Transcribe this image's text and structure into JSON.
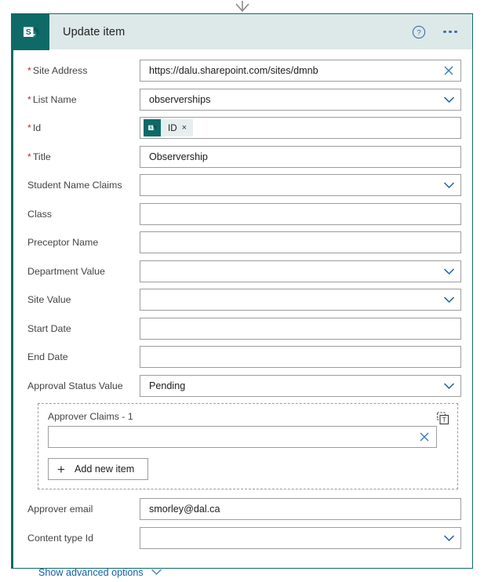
{
  "connector": {
    "icon": "arrow-down-icon"
  },
  "header": {
    "app_icon": "sharepoint-icon",
    "title": "Update item",
    "help_icon": "help-circle-icon",
    "more_icon": "ellipsis-icon"
  },
  "colors": {
    "accent_teal": "#0f6a67",
    "header_bg": "#dde8e8",
    "link_blue": "#0f5fa8",
    "chevron_blue": "#1b5fa8",
    "required_red": "#c1272d",
    "border_gray": "#9d9d9d"
  },
  "fields": [
    {
      "label": "Site Address",
      "required": true,
      "value": "https://dalu.sharepoint.com/sites/dmnb",
      "icon": "clear-x-icon",
      "type": "text"
    },
    {
      "label": "List Name",
      "required": true,
      "value": "observerships",
      "icon": "chevron-down-icon",
      "type": "dropdown"
    },
    {
      "label": "Id",
      "required": true,
      "value": "",
      "icon": "none",
      "type": "token",
      "token": {
        "icon": "sharepoint-icon",
        "label": "ID",
        "remove": "×"
      }
    },
    {
      "label": "Title",
      "required": true,
      "value": "Observership",
      "icon": "none",
      "type": "text"
    },
    {
      "label": "Student Name Claims",
      "required": false,
      "value": "",
      "icon": "chevron-down-icon",
      "type": "dropdown"
    },
    {
      "label": "Class",
      "required": false,
      "value": "",
      "icon": "none",
      "type": "text"
    },
    {
      "label": "Preceptor Name",
      "required": false,
      "value": "",
      "icon": "none",
      "type": "text"
    },
    {
      "label": "Department Value",
      "required": false,
      "value": "",
      "icon": "chevron-down-icon",
      "type": "dropdown"
    },
    {
      "label": "Site Value",
      "required": false,
      "value": "",
      "icon": "chevron-down-icon",
      "type": "dropdown"
    },
    {
      "label": "Start Date",
      "required": false,
      "value": "",
      "icon": "none",
      "type": "text"
    },
    {
      "label": "End Date",
      "required": false,
      "value": "",
      "icon": "none",
      "type": "text"
    },
    {
      "label": "Approval Status Value",
      "required": false,
      "value": "Pending",
      "icon": "chevron-down-icon",
      "type": "dropdown"
    }
  ],
  "array_block": {
    "title": "Approver Claims - 1",
    "tool_icon": "switch-to-text-mode-icon",
    "input_value": "",
    "input_icon": "clear-x-icon",
    "add_button": {
      "icon": "plus-icon",
      "label": "Add new item"
    }
  },
  "fields_after": [
    {
      "label": "Approver email",
      "required": false,
      "value": "smorley@dal.ca",
      "icon": "none",
      "type": "text"
    },
    {
      "label": "Content type Id",
      "required": false,
      "value": "",
      "icon": "chevron-down-icon",
      "type": "dropdown"
    }
  ],
  "advanced": {
    "label": "Show advanced options",
    "icon": "chevron-down-icon"
  }
}
